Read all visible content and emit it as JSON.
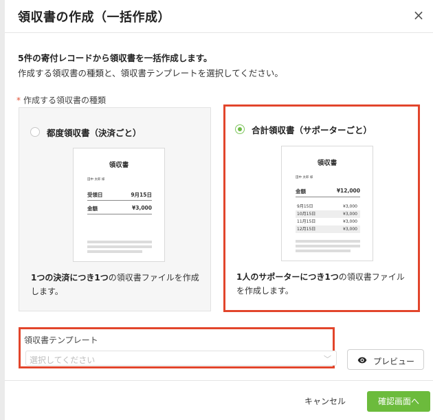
{
  "dialog": {
    "title": "領収書の作成（一括作成）",
    "close_symbol": "×"
  },
  "intro": {
    "line1": "5件の寄付レコードから領収書を一括作成します。",
    "line2": "作成する領収書の種類と、領収書テンプレートを選択してください。"
  },
  "receipt_type": {
    "required_mark": "*",
    "label": "作成する領収書の種類",
    "options": [
      {
        "title": "都度領収書（決済ごと）",
        "selected": false,
        "doc": {
          "title": "領収書",
          "name": "田中 太郎 様",
          "rows": [
            {
              "label": "受領日",
              "value": "9月15日"
            },
            {
              "label": "金額",
              "value": "¥3,000"
            }
          ]
        },
        "desc_bold1": "1つの決済につき1つ",
        "desc_rest": "の領収書ファイルを作成します。"
      },
      {
        "title": "合計領収書（サポーターごと）",
        "selected": true,
        "doc": {
          "title": "領収書",
          "name": "田中 太郎 様",
          "total_label": "金額",
          "total_value": "¥12,000",
          "items": [
            {
              "date": "9月15日",
              "amount": "¥3,000"
            },
            {
              "date": "10月15日",
              "amount": "¥3,000"
            },
            {
              "date": "11月15日",
              "amount": "¥3,000"
            },
            {
              "date": "12月15日",
              "amount": "¥3,000"
            }
          ]
        },
        "desc_bold1": "1人のサポーターにつき1つ",
        "desc_rest": "の領収書ファイルを作成します。"
      }
    ]
  },
  "template": {
    "label": "領収書テンプレート",
    "placeholder": "選択してください",
    "chevron": "﹀"
  },
  "preview_button": {
    "label": "プレビュー",
    "icon": "eye-icon"
  },
  "footer": {
    "cancel_label": "キャンセル",
    "confirm_label": "確認画面へ"
  },
  "colors": {
    "accent_green": "#6cbb3c",
    "highlight_red": "#e2452b",
    "required_red": "#e05236"
  }
}
